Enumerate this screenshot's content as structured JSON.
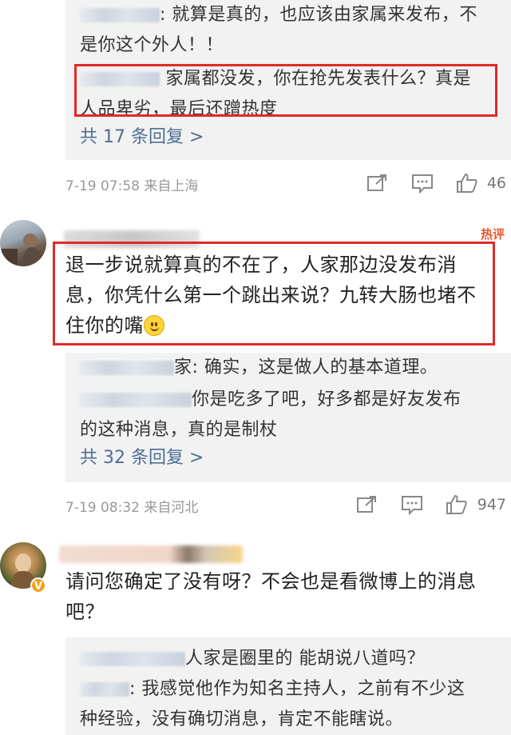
{
  "comment1": {
    "replies": [
      {
        "text": ": 就算是真的，也应该由家属来发布，不",
        "cont": "是你这个外人！！"
      },
      {
        "text": "家属都没发，你在抢先发表什么？真是",
        "cont": "人品卑劣，最后还蹭热度"
      }
    ],
    "more_replies": "共 17 条回复 >",
    "time": "7-19 07:58",
    "source": "来自上海",
    "likes": "46"
  },
  "comment2": {
    "hot_tag": "热评",
    "text_lines": [
      "退一步说就算真的不在了，人家那边没发布消",
      "息，你凭什么第一个跳出来说？九转大肠也堵不",
      "住你的嘴"
    ],
    "replies": [
      {
        "text": "家: 确实，这是做人的基本道理。"
      },
      {
        "text": "你是吃多了吧，好多都是好友发布",
        "cont": "的这种消息，真的是制杖"
      }
    ],
    "more_replies": "共 32 条回复 >",
    "time": "7-19 08:32",
    "source": "来自河北",
    "likes": "947"
  },
  "comment3": {
    "badge": "V",
    "text_lines": [
      "请问您确定了没有呀？不会也是看微博上的消息",
      "吧？"
    ],
    "replies": [
      {
        "text": "人家是圈里的 能胡说八道吗？"
      },
      {
        "text": ": 我感觉他作为知名主持人，之前有不少这",
        "cont": "种经验，没有确切消息，肯定不能瞎说。"
      }
    ]
  },
  "colors": {
    "highlight_border": "#e02a2a",
    "link": "#4e6e94",
    "reply_bg": "#f2f2f2",
    "hot": "#e8572c"
  },
  "icons": [
    "share-icon",
    "comment-icon",
    "like-icon",
    "smiley-emoji",
    "verified-badge"
  ]
}
